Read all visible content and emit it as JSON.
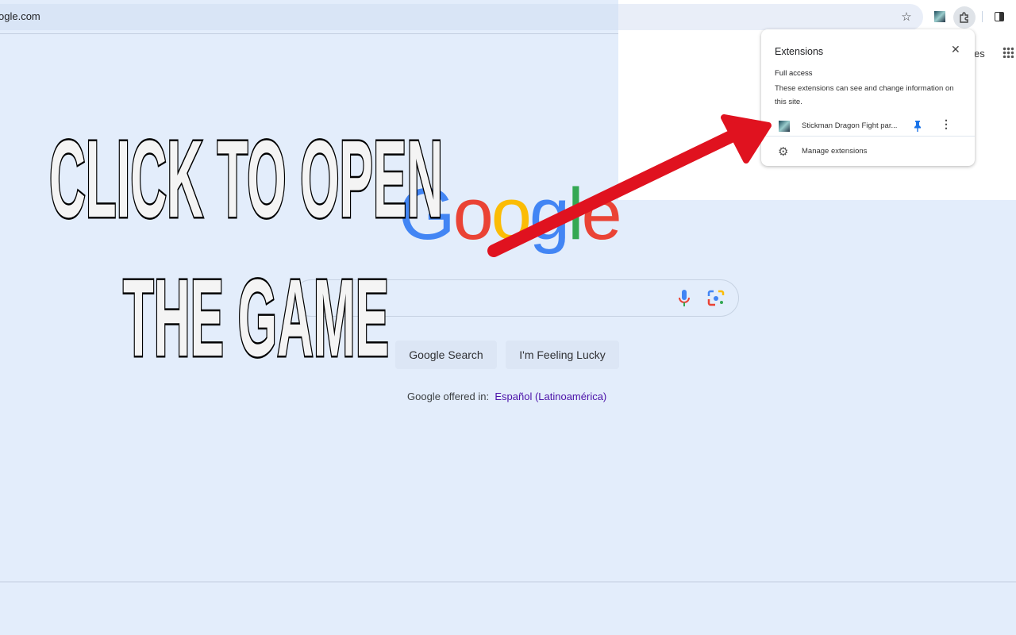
{
  "browser": {
    "url": "ogle.com",
    "icons": [
      "star-icon",
      "extension-avatar-icon",
      "puzzle-icon",
      "side-panel-icon"
    ]
  },
  "header_partial_text": "es",
  "extensions_popup": {
    "title": "Extensions",
    "section": "Full access",
    "description": "These extensions can see and change information on this site.",
    "extension_name": "Stickman Dragon Fight par...",
    "manage_label": "Manage extensions",
    "pin_color": "#1a73e8"
  },
  "overlay": {
    "line1": "CLICK TO OPEN",
    "line2": "THE GAME",
    "arrow_color": "#e0121f"
  },
  "google": {
    "logo": "Google",
    "search_button": "Google Search",
    "lucky_button": "I'm Feeling Lucky",
    "offered_in": "Google offered in:",
    "language_link": "Español (Latinoamérica)"
  }
}
